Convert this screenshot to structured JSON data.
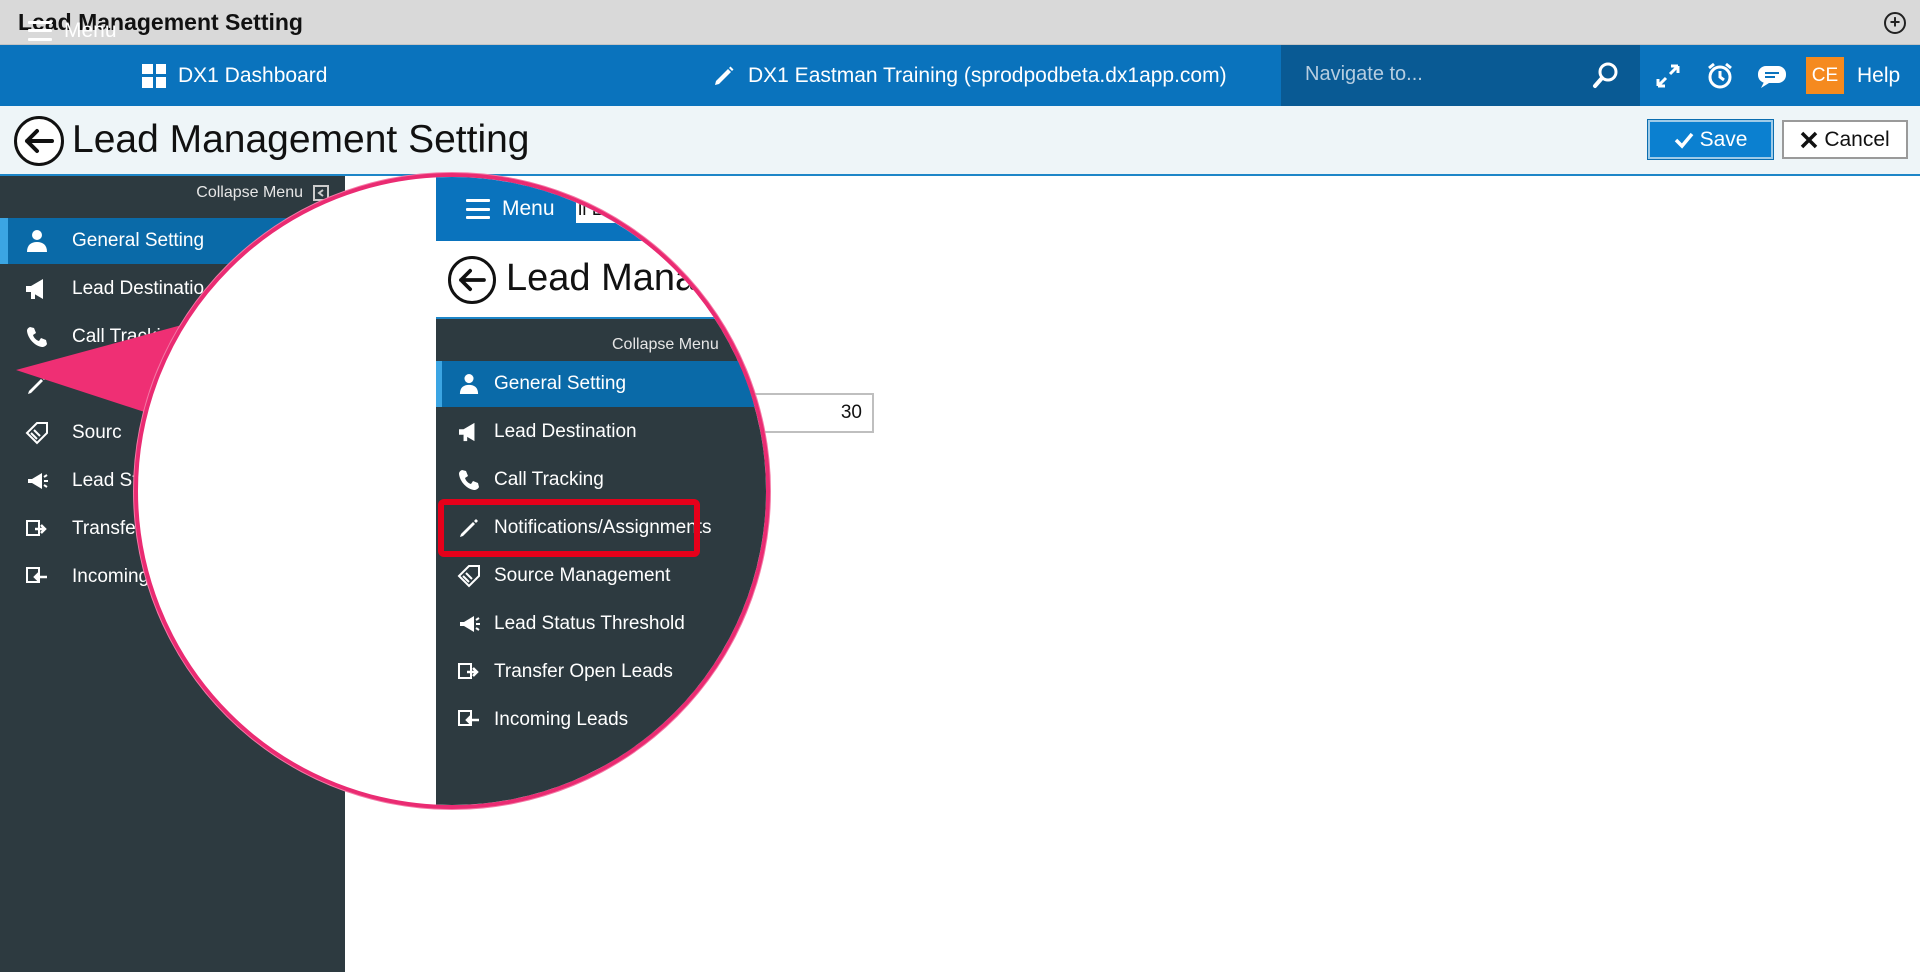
{
  "window": {
    "title": "Lead Management Setting"
  },
  "navbar": {
    "menu_label": "Menu",
    "dashboard_label": "DX1 Dashboard",
    "site_label": "DX1 Eastman Training (sprodpodbeta.dx1app.com)",
    "search_placeholder": "Navigate to...",
    "user_initials": "CE",
    "help_label": "Help"
  },
  "page": {
    "title": "Lead Management Setting",
    "save_label": "Save",
    "cancel_label": "Cancel"
  },
  "sidebar": {
    "collapse_label": "Collapse Menu",
    "items": [
      {
        "label": "General Setting",
        "icon": "user-icon",
        "active": true
      },
      {
        "label": "Lead Destination",
        "icon": "megaphone-icon"
      },
      {
        "label": "Call Tracking",
        "icon": "phone-icon"
      },
      {
        "label": "Notifications/Assignments",
        "icon": "pencil-icon"
      },
      {
        "label": "Source Management",
        "icon": "tag-icon"
      },
      {
        "label": "Lead Status Threshold",
        "icon": "horn-icon"
      },
      {
        "label": "Transfer Open Leads",
        "icon": "transfer-icon"
      },
      {
        "label": "Incoming Leads",
        "icon": "incoming-icon"
      }
    ],
    "visible_truncated": [
      "General Setting",
      "Lead Destinatio",
      "Call Trackin",
      "",
      "Sourc",
      "Lead St",
      "Transfe",
      "Incoming"
    ]
  },
  "content": {
    "field_value": "30"
  },
  "magnifier": {
    "menu_label": "Menu",
    "crumb": "ll Leads",
    "title": "Lead Mana",
    "collapse_label": "Collapse Menu",
    "highlighted_item": "Notifications/Assignments"
  },
  "colors": {
    "brand_blue": "#0a73bd",
    "sidebar_bg": "#2d3a40",
    "highlight_red": "#e6001a",
    "callout_pink": "#ea2b72",
    "avatar_orange": "#f58a1f"
  }
}
